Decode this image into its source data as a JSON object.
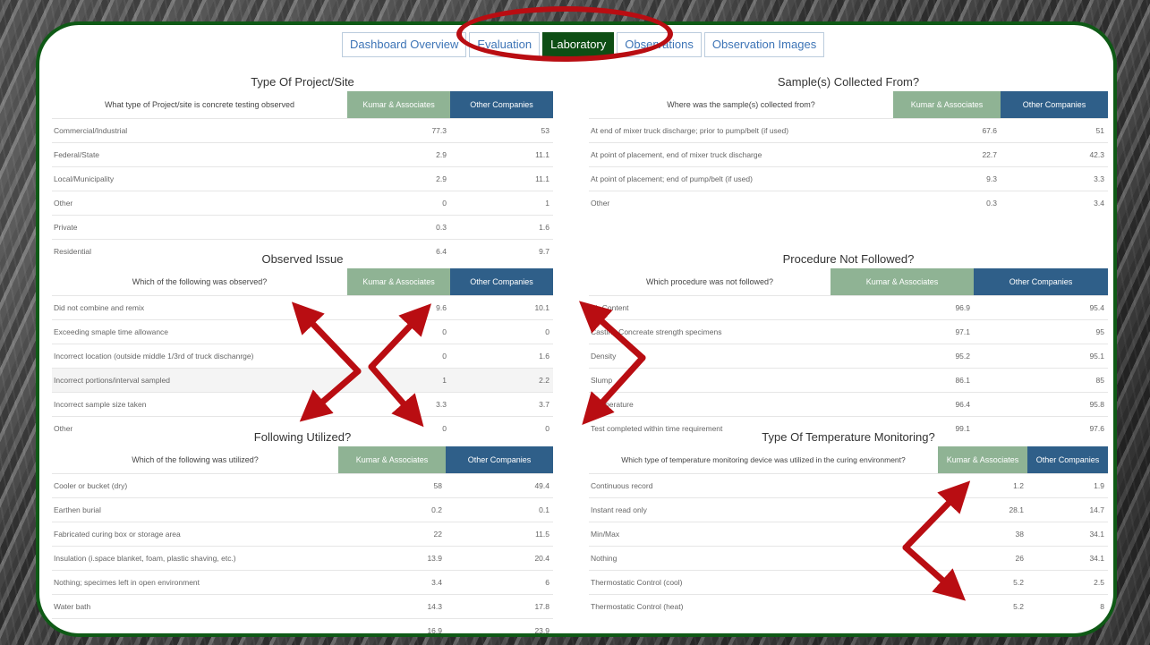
{
  "tabs": [
    "Dashboard Overview",
    "Evaluation",
    "Laboratory",
    "Observations",
    "Observation Images"
  ],
  "active_tab": "Laboratory",
  "companies": {
    "kumar": "Kumar & Associates",
    "other": "Other Companies"
  },
  "sections": {
    "project": {
      "title": "Type Of Project/Site",
      "question": "What type of Project/site is concrete testing observed",
      "rows": [
        [
          "Commercial/Industrial",
          "77.3",
          "53"
        ],
        [
          "Federal/State",
          "2.9",
          "11.1"
        ],
        [
          "Local/Municipality",
          "2.9",
          "11.1"
        ],
        [
          "Other",
          "0",
          "1"
        ],
        [
          "Private",
          "0.3",
          "1.6"
        ],
        [
          "Residential",
          "6.4",
          "9.7"
        ]
      ]
    },
    "sample": {
      "title": "Sample(s) Collected From?",
      "question": "Where was the sample(s) collected from?",
      "rows": [
        [
          "At end of mixer truck discharge; prior to pump/belt (if used)",
          "67.6",
          "51"
        ],
        [
          "At point of placement, end of mixer truck discharge",
          "22.7",
          "42.3"
        ],
        [
          "At point of placement; end of pump/belt (if used)",
          "9.3",
          "3.3"
        ],
        [
          "Other",
          "0.3",
          "3.4"
        ]
      ]
    },
    "issue": {
      "title": "Observed Issue",
      "question": "Which of the following was observed?",
      "rows": [
        [
          "Did not combine and remix",
          "9.6",
          "10.1"
        ],
        [
          "Exceeding smaple time allowance",
          "0",
          "0"
        ],
        [
          "Incorrect location (outside middle 1/3rd of truck dischanrge)",
          "0",
          "1.6"
        ],
        [
          "Incorrect portions/interval sampled",
          "1",
          "2.2"
        ],
        [
          "Incorrect sample size taken",
          "3.3",
          "3.7"
        ],
        [
          "Other",
          "0",
          "0"
        ]
      ]
    },
    "procedure": {
      "title": "Procedure Not Followed?",
      "question": "Which procedure was not followed?",
      "rows": [
        [
          "Air Content",
          "96.9",
          "95.4"
        ],
        [
          "Casting Concreate strength specimens",
          "97.1",
          "95"
        ],
        [
          "Density",
          "95.2",
          "95.1"
        ],
        [
          "Slump",
          "86.1",
          "85"
        ],
        [
          "Temperature",
          "96.4",
          "95.8"
        ],
        [
          "Test completed within time requirement",
          "99.1",
          "97.6"
        ]
      ]
    },
    "utilized": {
      "title": "Following Utilized?",
      "question": "Which of the following was utilized?",
      "rows": [
        [
          "Cooler or bucket (dry)",
          "58",
          "49.4"
        ],
        [
          "Earthen burial",
          "0.2",
          "0.1"
        ],
        [
          "Fabricated curing box or storage area",
          "22",
          "11.5"
        ],
        [
          "Insulation (i.space blanket, foam, plastic shaving, etc.)",
          "13.9",
          "20.4"
        ],
        [
          "Nothing; specimes left in open environment",
          "3.4",
          "6"
        ],
        [
          "Water bath",
          "14.3",
          "17.8"
        ],
        [
          "",
          "16.9",
          "23.9"
        ]
      ]
    },
    "temperature": {
      "title": "Type Of Temperature Monitoring?",
      "question": "Which type of temperature monitoring device was utilized in the curing environment?",
      "rows": [
        [
          "Continuous record",
          "1.2",
          "1.9"
        ],
        [
          "Instant read only",
          "28.1",
          "14.7"
        ],
        [
          "Min/Max",
          "38",
          "34.1"
        ],
        [
          "Nothing",
          "26",
          "34.1"
        ],
        [
          "Thermostatic Control (cool)",
          "5.2",
          "2.5"
        ],
        [
          "Thermostatic Control (heat)",
          "5.2",
          "8"
        ]
      ]
    }
  },
  "colors": {
    "active_tab": "#0e4e14",
    "kumar_header": "#8fb394",
    "other_header": "#2f5f89",
    "annotation": "#b90d12",
    "frame": "#0f5a16"
  }
}
